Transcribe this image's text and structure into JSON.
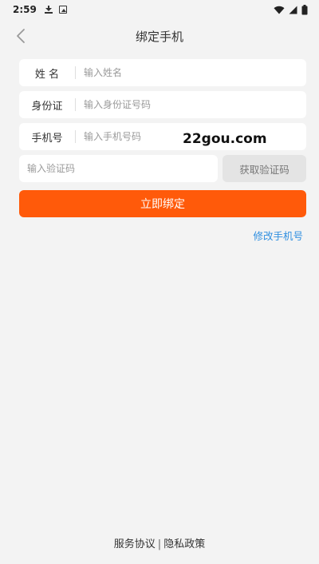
{
  "status_bar": {
    "time": "2:59",
    "icons": [
      "download-icon",
      "image-icon",
      "wifi-icon",
      "signal-icon",
      "battery-icon"
    ]
  },
  "header": {
    "title": "绑定手机",
    "back_icon": "chevron-left-icon"
  },
  "form": {
    "name": {
      "label": "姓 名",
      "placeholder": "输入姓名",
      "value": ""
    },
    "id_card": {
      "label": "身份证",
      "placeholder": "输入身份证号码",
      "value": ""
    },
    "phone": {
      "label": "手机号",
      "placeholder": "输入手机号码",
      "value": ""
    },
    "code": {
      "placeholder": "输入验证码",
      "value": "",
      "button_label": "获取验证码"
    }
  },
  "submit_label": "立即绑定",
  "change_phone_link": "修改手机号",
  "watermark": "22gou.com",
  "footer": {
    "service_agreement": "服务协议",
    "divider": "|",
    "privacy_policy": "隐私政策"
  },
  "colors": {
    "primary": "#ff5a0a",
    "link": "#2f8fe0",
    "background": "#f3f3f3"
  }
}
